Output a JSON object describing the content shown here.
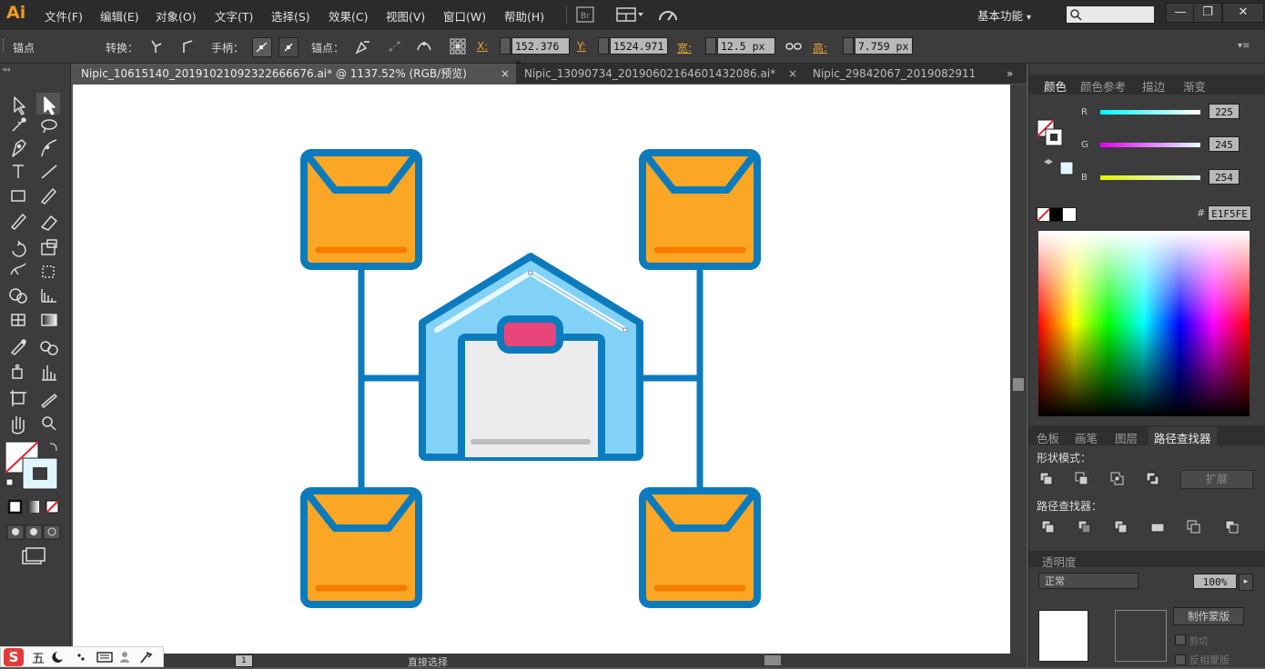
{
  "app": {
    "logo": "Ai"
  },
  "menu": [
    "文件(F)",
    "编辑(E)",
    "对象(O)",
    "文字(T)",
    "选择(S)",
    "效果(C)",
    "视图(V)",
    "窗口(W)",
    "帮助(H)"
  ],
  "workspace": {
    "label": "基本功能",
    "chevron": "▾"
  },
  "window_controls": {
    "minimize": "—",
    "restore": "❐",
    "close": "✕"
  },
  "control_bar": {
    "selection_label": "锚点",
    "convert_label": "转换：",
    "handle_label": "手柄：",
    "anchor_label": "锚点：",
    "x_label": "X:",
    "x_value": "152.376 p",
    "y_label": "Y:",
    "y_value": "1524.971",
    "w_label": "宽:",
    "w_value": "12.5 px",
    "h_label": "高:",
    "h_value": "7.759 px"
  },
  "tabs": [
    {
      "label": "Nipic_10615140_20191021092322666676.ai* @ 1137.52% (RGB/预览)",
      "close": "×"
    },
    {
      "label": "Nipic_13090734_20190602164601432086.ai*",
      "close": "×"
    },
    {
      "label": "Nipic_29842067_2019082911"
    }
  ],
  "tabs_overflow": "»",
  "color_panel": {
    "tabs": [
      "颜色",
      "颜色参考",
      "描边",
      "渐变"
    ],
    "r_label": "R",
    "r_value": "225",
    "g_label": "G",
    "g_value": "245",
    "b_label": "B",
    "b_value": "254",
    "hex_label": "#",
    "hex_value": "E1F5FE",
    "current_color": "#E1F5FE"
  },
  "pathfinder_panel": {
    "tabs": [
      "色板",
      "画笔",
      "图层",
      "路径查找器"
    ],
    "shape_modes_label": "形状模式：",
    "expand_label": "扩展",
    "pathfinders_label": "路径查找器："
  },
  "transparency_panel": {
    "tab": "透明度",
    "mode": "正常",
    "opacity": "100%",
    "make_mask": "制作蒙版",
    "clip": "剪切",
    "invert_mask": "反相蒙版"
  },
  "status_bar": {
    "zoom": "1",
    "tool_label": "直接选择"
  },
  "ime": {
    "brand": "S",
    "mode": "五"
  },
  "illustration_colors": {
    "stroke": "#0c7bbd",
    "box": "#fba625",
    "stripe": "#f47d00",
    "house": "#82d2f7",
    "door": "#ececec",
    "sign": "#e8457a"
  }
}
